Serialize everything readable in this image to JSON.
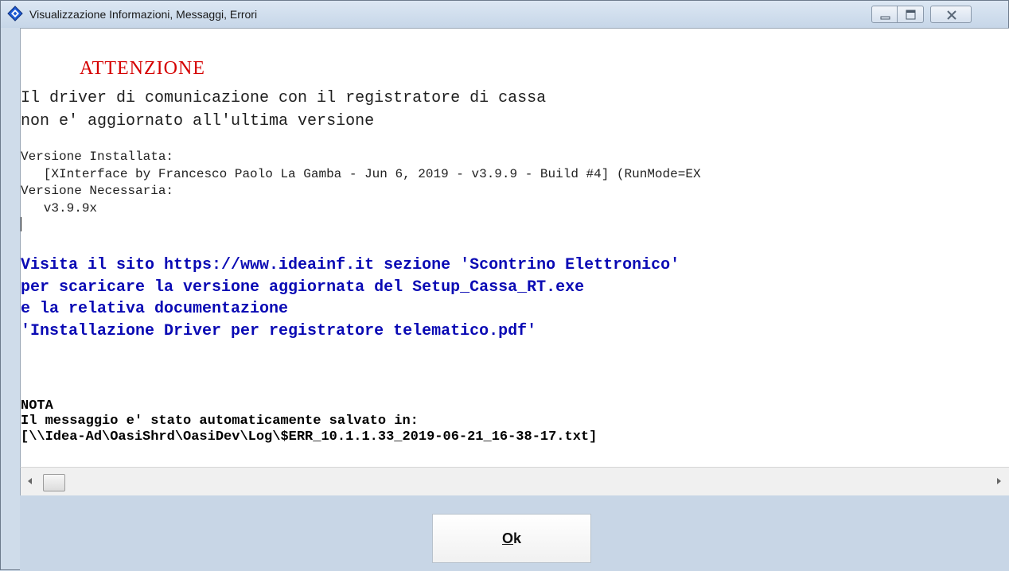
{
  "window": {
    "title": "Visualizzazione Informazioni, Messaggi, Errori",
    "icon": "diamond-app-icon",
    "controls": [
      "minimize-icon",
      "maximize-icon",
      "close-icon"
    ]
  },
  "message": {
    "heading": "ATTENZIONE",
    "intro_line1": "Il driver di comunicazione con il registratore di cassa",
    "intro_line2": "non e' aggiornato all'ultima versione",
    "installed_label": "Versione Installata:",
    "installed_value": "   [XInterface by Francesco Paolo La Gamba - Jun 6, 2019 - v3.9.9 - Build #4] (RunMode=EX",
    "required_label": "Versione Necessaria:",
    "required_value": "   v3.9.9x",
    "visit_line1": "Visita il sito https://www.ideainf.it sezione 'Scontrino Elettronico'",
    "visit_line2": "per scaricare la versione aggiornata del Setup_Cassa_RT.exe",
    "visit_line3": "e la relativa documentazione",
    "visit_line4": "'Installazione Driver per registratore telematico.pdf'",
    "note_label": "NOTA",
    "note_line1": "Il messaggio e' stato automaticamente salvato in:",
    "note_line2": "[\\\\Idea-Ad\\OasiShrd\\OasiDev\\Log\\$ERR_10.1.1.33_2019-06-21_16-38-17.txt]"
  },
  "buttons": {
    "ok_first": "O",
    "ok_rest": "k"
  },
  "colors": {
    "heading": "#d50000",
    "link_text": "#0a0ab4",
    "window_frame": "#cfdcea"
  }
}
